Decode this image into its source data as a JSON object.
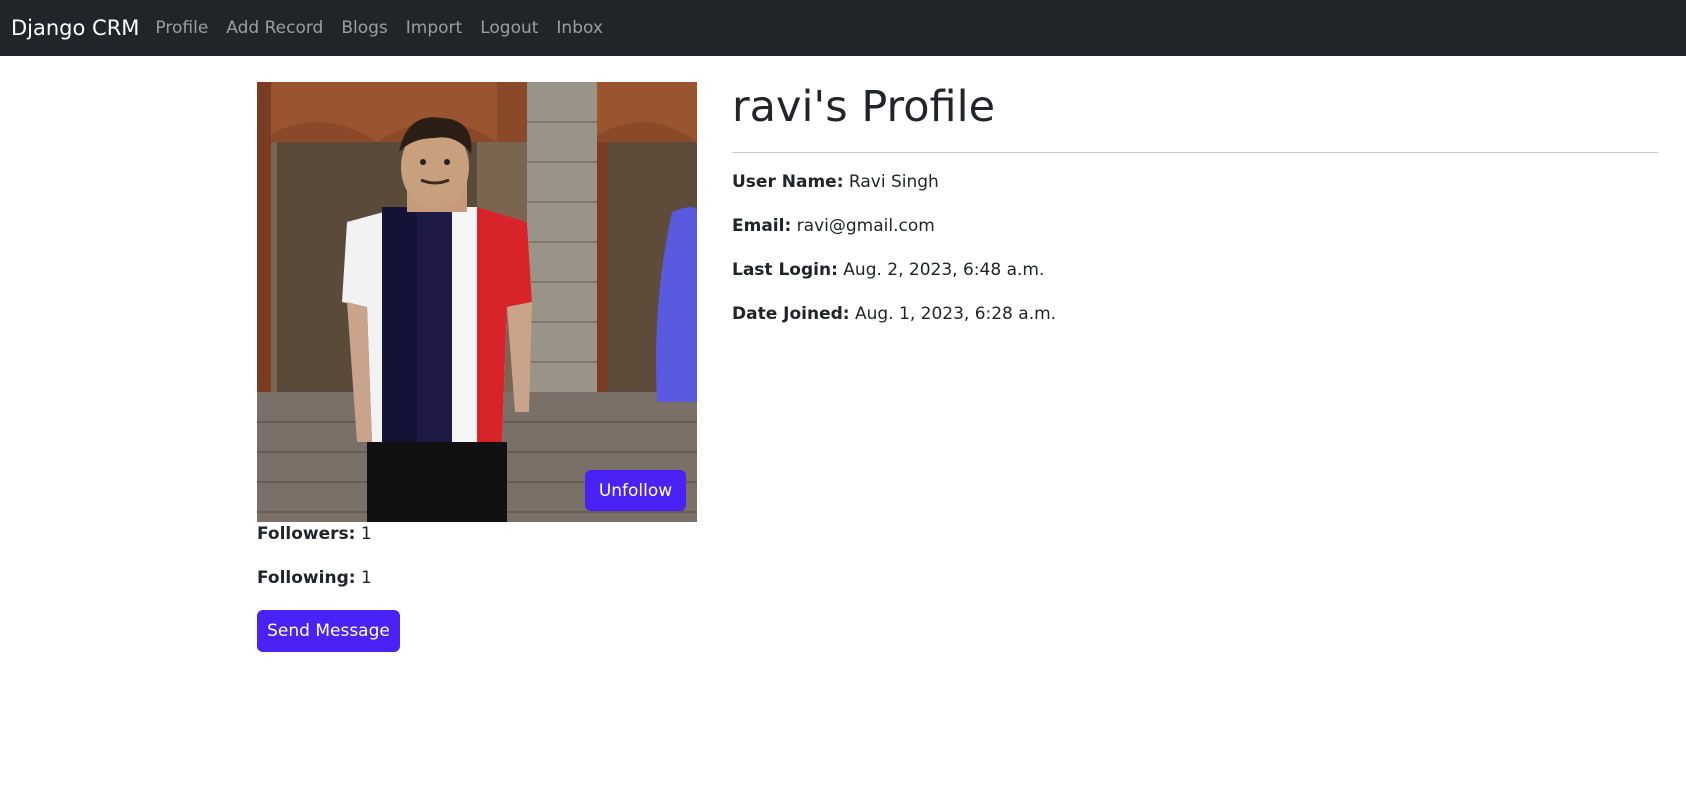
{
  "nav": {
    "brand": "Django CRM",
    "links": [
      "Profile",
      "Add Record",
      "Blogs",
      "Import",
      "Logout",
      "Inbox"
    ]
  },
  "profile": {
    "title": "ravi's Profile",
    "username_label": "User Name:",
    "username": "Ravi Singh",
    "email_label": "Email:",
    "email": "ravi@gmail.com",
    "last_login_label": "Last Login:",
    "last_login": "Aug. 2, 2023, 6:48 a.m.",
    "date_joined_label": "Date Joined:",
    "date_joined": "Aug. 1, 2023, 6:28 a.m."
  },
  "stats": {
    "followers_label": "Followers:",
    "followers": "1",
    "following_label": "Following:",
    "following": "1"
  },
  "buttons": {
    "unfollow": "Unfollow",
    "send_message": "Send Message"
  },
  "colors": {
    "navbar_bg": "#212529",
    "accent": "#4a22f5"
  }
}
